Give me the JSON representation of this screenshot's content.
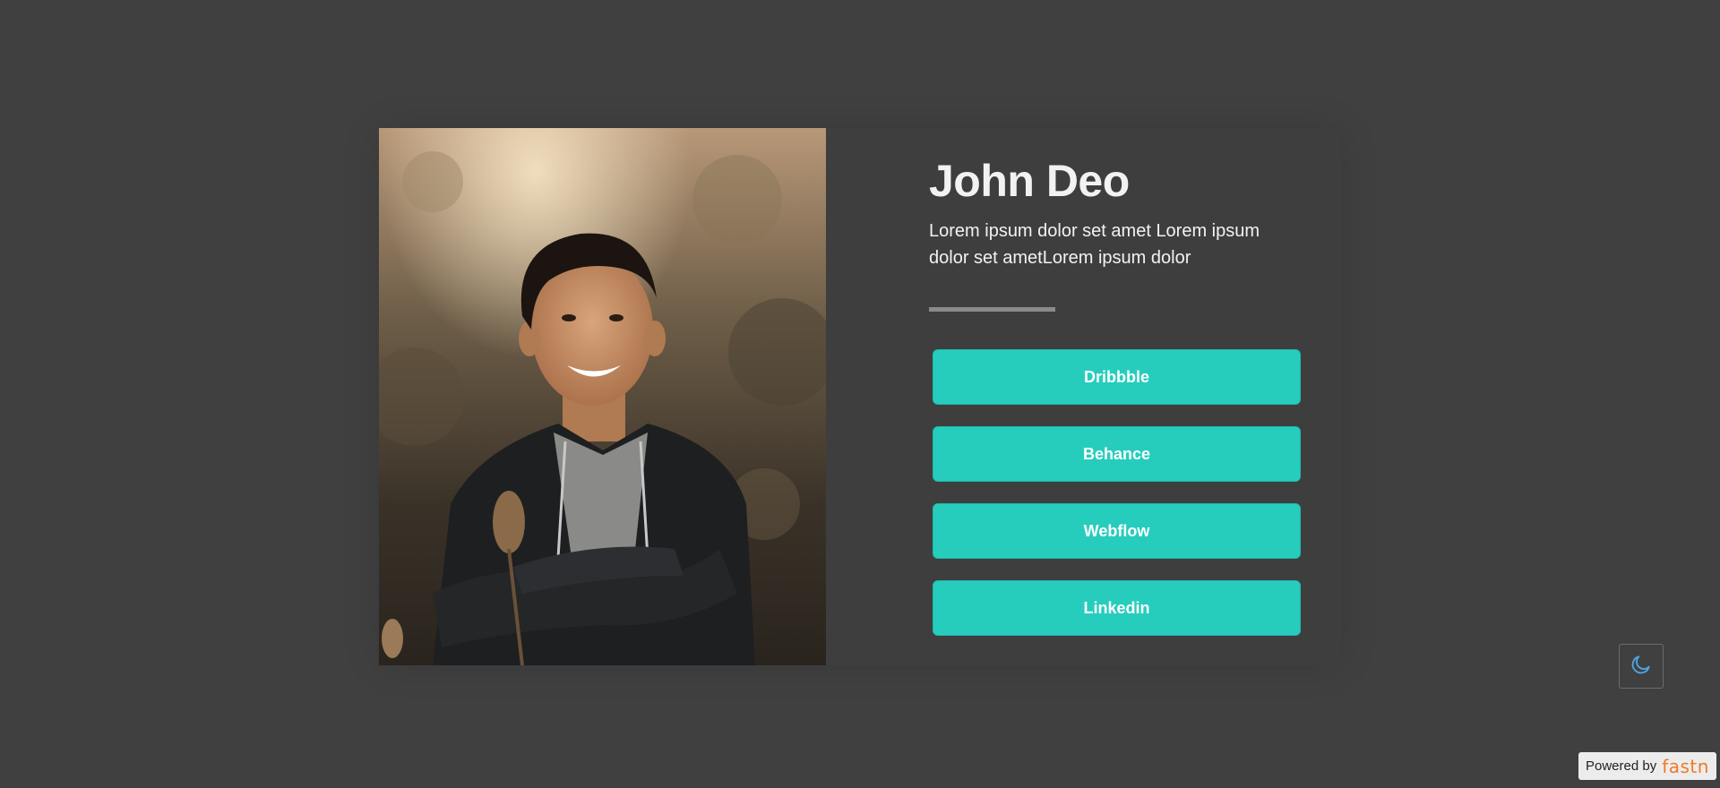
{
  "profile": {
    "name": "John Deo",
    "bio": "Lorem ipsum dolor set amet Lorem ipsum dolor set ametLorem ipsum dolor"
  },
  "links": [
    {
      "label": "Dribbble"
    },
    {
      "label": "Behance"
    },
    {
      "label": "Webflow"
    },
    {
      "label": "Linkedin"
    }
  ],
  "theme_toggle": {
    "icon": "moon-icon"
  },
  "footer": {
    "powered_label": "Powered by",
    "brand": "fastn"
  },
  "colors": {
    "background": "#404040",
    "card": "#3e3e3e",
    "accent": "#26cdbd",
    "brand": "#ef7a2a",
    "moon": "#4ea3e0"
  }
}
